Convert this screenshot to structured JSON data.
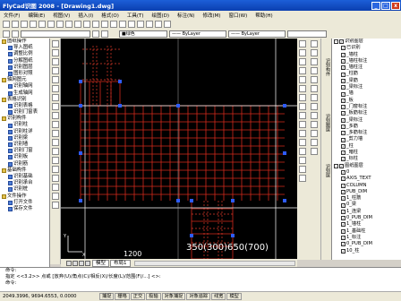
{
  "window": {
    "title": "FlyCad识图 2008 - [Drawing1.dwg]"
  },
  "menu": [
    "文件(F)",
    "编辑(E)",
    "视图(V)",
    "插入(I)",
    "格式(O)",
    "工具(T)",
    "绘图(D)",
    "标注(N)",
    "修改(M)",
    "窗口(W)",
    "帮助(H)"
  ],
  "toolbar": {
    "color_value": "■绿色",
    "linetype_value": "—— ByLayer",
    "lineweight_value": "—— ByLayer"
  },
  "left_tree": [
    {
      "label": "图纸操作",
      "level": 0
    },
    {
      "label": "导入图纸",
      "level": 1
    },
    {
      "label": "调整比例",
      "level": 1
    },
    {
      "label": "分解图纸",
      "level": 1
    },
    {
      "label": "识别图层",
      "level": 1
    },
    {
      "label": "图形对照",
      "level": 1
    },
    {
      "label": "轴网图元",
      "level": 0
    },
    {
      "label": "识别轴网",
      "level": 1
    },
    {
      "label": "生成轴网",
      "level": 1
    },
    {
      "label": "表格识别",
      "level": 0
    },
    {
      "label": "识别表格",
      "level": 1
    },
    {
      "label": "识别门窗表",
      "level": 1
    },
    {
      "label": "识别构件",
      "level": 0
    },
    {
      "label": "识别柱",
      "level": 1
    },
    {
      "label": "识别柱详",
      "level": 1
    },
    {
      "label": "识别梁",
      "level": 1
    },
    {
      "label": "识别墙",
      "level": 1
    },
    {
      "label": "识别门窗",
      "level": 1
    },
    {
      "label": "识别板",
      "level": 1
    },
    {
      "label": "识别筋",
      "level": 1
    },
    {
      "label": "基础构件",
      "level": 0
    },
    {
      "label": "识别基础",
      "level": 1
    },
    {
      "label": "识别承台",
      "level": 1
    },
    {
      "label": "识别桩",
      "level": 1
    },
    {
      "label": "文件操作",
      "level": 0
    },
    {
      "label": "打开文件",
      "level": 1
    },
    {
      "label": "保存文件",
      "level": 1
    }
  ],
  "canvas": {
    "label_bottom": "350(300)650(700)",
    "label_small": "1200",
    "axis_x": "X",
    "axis_y": "Y"
  },
  "tabs": [
    "模型",
    "布局1"
  ],
  "side_labels": [
    "识别构件",
    "识别图层",
    "识别层"
  ],
  "layers": {
    "group1": "识别图层",
    "items1": [
      "已识别",
      "_墙柱",
      "_墙柱标注",
      "_墙柱注",
      "_柱筋",
      "_梁筋",
      "_梁标注",
      "_墙",
      "_板",
      "_门窗标注",
      "_板筋标注",
      "_梁标注",
      "_多筋",
      "_多筋标注",
      "_剪力墙",
      "_柱",
      "_暗柱",
      "_标柱"
    ],
    "group2": "图纸图层",
    "items2": [
      "0",
      "AXIS_TEXT",
      "COLUMN",
      "PUB_DIM",
      "1_柱筋",
      "0_梁",
      "1_连梁",
      "0_PUB_DIM",
      "1_墙柱",
      "1_基础柱",
      "1_标注",
      "0_PUB_DIM",
      "10_柱"
    ]
  },
  "cmdline": [
    "命令:",
    "指定 <<3.2>> 点或 [放弃(U)/角点(C)/相反(X)/长度(L)/范围(F)/...] <>:",
    "命令:"
  ],
  "status": {
    "coords": "2049.3996,  9694.6553, 0.0000",
    "buttons": [
      "捕捉",
      "栅格",
      "正交",
      "极轴",
      "对象捕捉",
      "对象追踪",
      "线宽",
      "模型"
    ]
  }
}
